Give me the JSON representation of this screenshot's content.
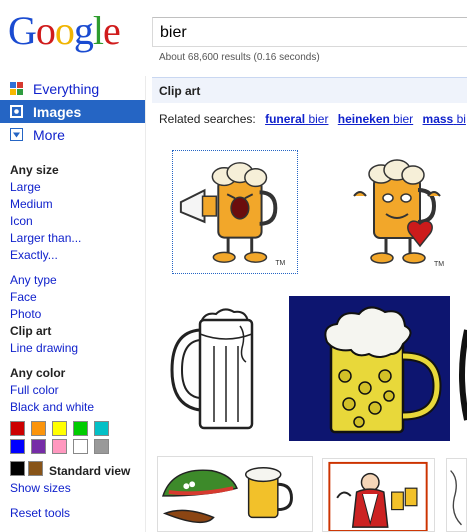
{
  "header": {
    "logo_letters": [
      {
        "char": "G",
        "color": "#1a4bd1"
      },
      {
        "char": "o",
        "color": "#d01b1b"
      },
      {
        "char": "o",
        "color": "#f0b400"
      },
      {
        "char": "g",
        "color": "#1a4bd1"
      },
      {
        "char": "l",
        "color": "#2e9c2e"
      },
      {
        "char": "e",
        "color": "#d01b1b"
      }
    ],
    "search_value": "bier",
    "stats": "About 68,600 results (0.16 seconds)"
  },
  "nav": {
    "items": [
      {
        "label": "Everything",
        "icon": "everything-icon"
      },
      {
        "label": "Images",
        "icon": "images-icon",
        "active": true
      },
      {
        "label": "More",
        "icon": "chevron-down-icon"
      }
    ]
  },
  "filters": {
    "size_head": "Any size",
    "size_links": [
      "Large",
      "Medium",
      "Icon",
      "Larger than...",
      "Exactly..."
    ],
    "type_links": [
      "Any type",
      "Face",
      "Photo"
    ],
    "type_current": "Clip art",
    "type_after": "Line drawing",
    "color_head": "Any color",
    "color_links": [
      "Full color",
      "Black and white"
    ],
    "swatch_colors": [
      "#cc0000",
      "#fb940b",
      "#ffff00",
      "#00cc00",
      "#03c0c6",
      "#0000ff",
      "#762ca7",
      "#ff98bf",
      "#ffffff",
      "#999999",
      "#000000",
      "#885418"
    ],
    "standard_view": "Standard view",
    "show_sizes": "Show sizes",
    "reset_tools": "Reset tools"
  },
  "main": {
    "section_title": "Clip art",
    "related_prefix": "Related searches:",
    "related": [
      {
        "bold": "funeral",
        "normal": "bier"
      },
      {
        "bold": "heineken",
        "normal": "bier"
      },
      {
        "bold": "mass",
        "normal": "bi"
      }
    ],
    "thumbnails": [
      {
        "name": "beer-mug-megaphone-cartoon",
        "mark": "TM"
      },
      {
        "name": "beer-mug-heart-cartoon",
        "mark": "TM"
      },
      {
        "name": "beer-stein-outline"
      },
      {
        "name": "beer-stein-yellow-blue-bg"
      },
      {
        "name": "partial-image-black-ring"
      },
      {
        "name": "bavarian-hat-beer"
      },
      {
        "name": "oktoberfest-waiter"
      },
      {
        "name": "partial-image-edge"
      }
    ]
  }
}
